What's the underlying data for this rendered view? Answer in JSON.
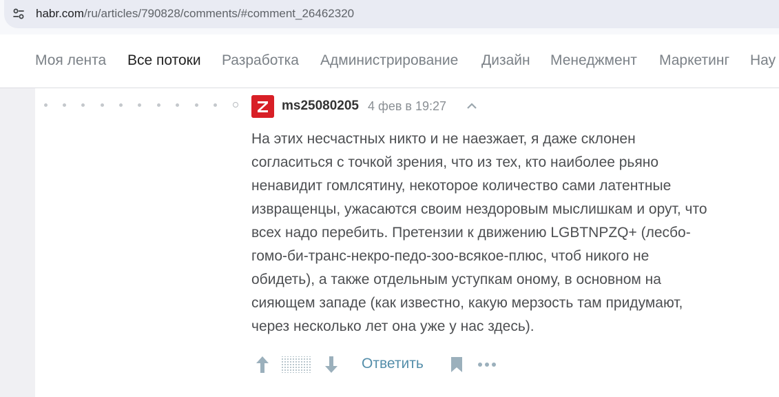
{
  "browser": {
    "url_host": "habr.com",
    "url_path": "/ru/articles/790828/comments/#comment_26462320"
  },
  "nav": {
    "items": [
      {
        "label": "Моя лента",
        "active": false
      },
      {
        "label": "Все потоки",
        "active": true
      },
      {
        "label": "Разработка",
        "active": false
      },
      {
        "label": "Администрирование",
        "active": false
      },
      {
        "label": "Дизайн",
        "active": false
      },
      {
        "label": "Менеджмент",
        "active": false
      },
      {
        "label": "Маркетинг",
        "active": false
      },
      {
        "label": "Нау",
        "active": false
      }
    ]
  },
  "comment": {
    "author": "ms25080205",
    "date": "4 фев в 19:27",
    "avatar_color": "#d81f26",
    "text_lines": [
      "На этих несчастных никто и не наезжает, я даже склонен",
      "согласиться с точкой зрения, что из тех, кто наиболее рьяно",
      "ненавидит гомлсятину, некоторое количество сами латентные",
      "извращенцы, ужасаются своим нездоровым мыслишкам и орут, что",
      "всех надо перебить. Претензии к движению LGBTNPZQ+ (лесбо-",
      "гомо-би-транс-некро-педо-зоо-всякое-плюс, чтоб никого не",
      "обидеть), а также отдельным уступкам оному, в основном на",
      "сияющем западе (как известно, какую мерзость там придумают,",
      "через несколько лет она уже у нас здесь)."
    ],
    "actions": {
      "reply_label": "Ответить",
      "icons": [
        "upvote-arrow-icon",
        "rating-hidden-icon",
        "downvote-arrow-icon",
        "bookmark-icon",
        "more-dots-icon"
      ]
    }
  },
  "colors": {
    "accent_link": "#548eaa",
    "active_nav": "#222222",
    "inactive_nav": "#7b8187"
  }
}
